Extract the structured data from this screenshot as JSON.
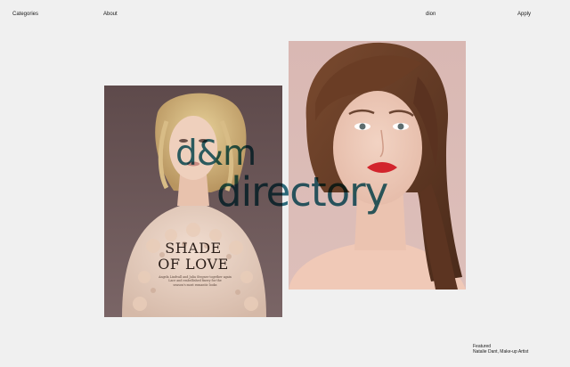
{
  "nav": {
    "left": [
      {
        "label": "Categories"
      },
      {
        "label": "About"
      }
    ],
    "right": [
      {
        "label": "dion"
      },
      {
        "label": "Apply"
      }
    ]
  },
  "brand": {
    "line_1": "d&m",
    "line_2": "directory"
  },
  "gallery": {
    "left_image": {
      "headline_1": "SHADE",
      "headline_2": "OF LOVE",
      "body_1": "Angela Lindvall and Julia Stegner together again",
      "body_2": "Lace and embellished finery for the",
      "body_3": "season's most romantic looks"
    }
  },
  "footer": {
    "label": "Featured",
    "caption": "Natalie Dant, Make-up Artist"
  },
  "colors": {
    "background": "#f0f0f0",
    "brand_teal": "#2d6e7f",
    "lipstick_red": "#d2242c"
  }
}
